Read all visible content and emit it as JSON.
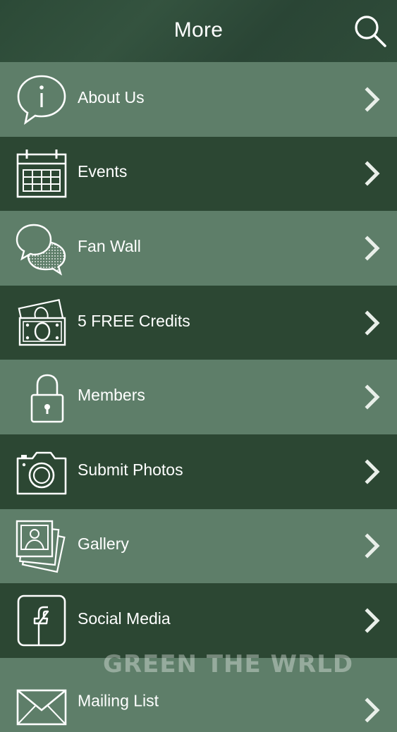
{
  "header": {
    "title": "More",
    "search_icon": "search-icon"
  },
  "menu": {
    "items": [
      {
        "label": "About Us",
        "icon": "info-bubble-icon"
      },
      {
        "label": "Events",
        "icon": "calendar-icon"
      },
      {
        "label": "Fan Wall",
        "icon": "chat-bubbles-icon"
      },
      {
        "label": "5 FREE Credits",
        "icon": "money-icon"
      },
      {
        "label": "Members",
        "icon": "lock-icon"
      },
      {
        "label": "Submit Photos",
        "icon": "camera-icon"
      },
      {
        "label": "Gallery",
        "icon": "photos-icon"
      },
      {
        "label": "Social Media",
        "icon": "facebook-icon"
      },
      {
        "label": "Mailing List",
        "icon": "envelope-icon"
      }
    ]
  },
  "watermark": {
    "text": "GREEN THE WRLD"
  },
  "colors": {
    "header_bg": "#2f4c39",
    "row_light": "#5e7e69",
    "row_dark": "#2c4733",
    "text": "#ffffff"
  }
}
